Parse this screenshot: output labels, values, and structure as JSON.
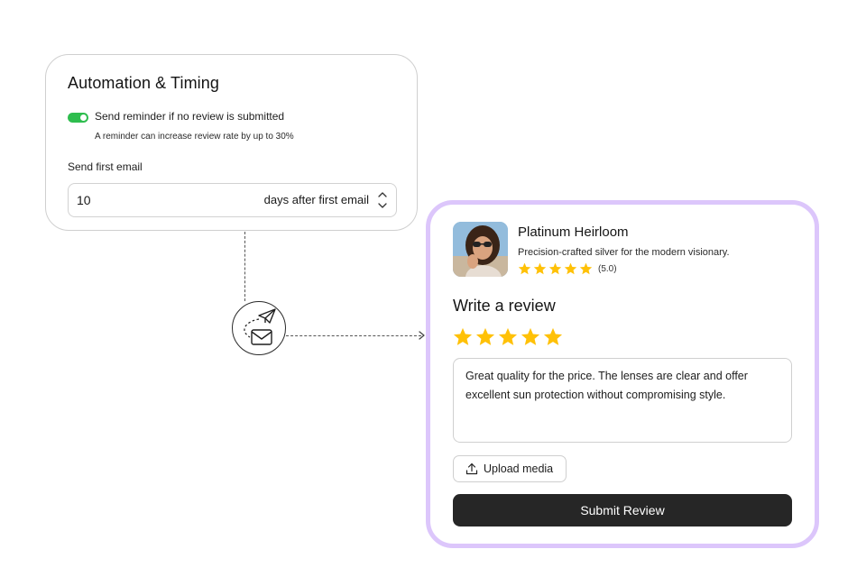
{
  "automation": {
    "title": "Automation & Timing",
    "reminder_toggle": {
      "on": true,
      "color": "#2ebd4e"
    },
    "reminder_label": "Send reminder if no review is submitted",
    "reminder_hint": "A reminder can increase review rate by up to 30%",
    "first_email_label": "Send first email",
    "days_value": "10",
    "days_suffix": "days after first email",
    "stepper_icon": "chevron-up-down-icon"
  },
  "connector": {
    "node_icons": [
      "paper-plane-icon",
      "envelope-icon"
    ]
  },
  "review": {
    "card_border_color": "#dcc6fb",
    "product_name": "Platinum Heirloom",
    "product_description": "Precision-crafted silver for the modern visionary.",
    "product_rating_stars": 5,
    "product_rating_text": "(5.0)",
    "star_color": "#ffc107",
    "write_title": "Write a review",
    "selected_stars": 5,
    "review_text": "Great quality for the price. The lenses are clear and offer excellent sun protection without compromising style.",
    "upload_label": "Upload media",
    "upload_icon": "upload-icon",
    "submit_label": "Submit Review",
    "submit_color": "#262626"
  }
}
